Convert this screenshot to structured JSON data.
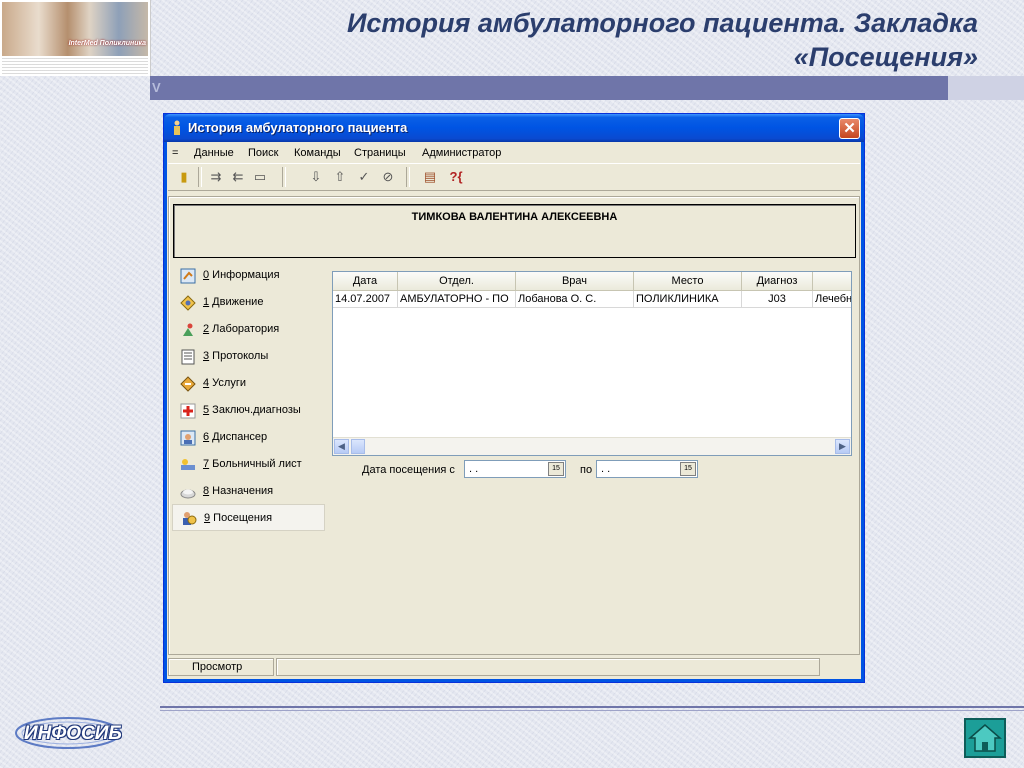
{
  "slide": {
    "title_line1": "История амбулаторного пациента. Закладка",
    "title_line2": "«Посещения»",
    "banner_logo": "InterMed Поликлиника",
    "footer_logo": "ИНФОСИБ",
    "corner_mark": "V"
  },
  "window": {
    "title": "История амбулаторного пациента",
    "close_glyph": "✕"
  },
  "menu": {
    "items": [
      "=",
      "Данные",
      "Поиск",
      "Команды",
      "Страницы",
      "Администратор"
    ]
  },
  "toolbar": {
    "glyphs": [
      "▮",
      "⇉",
      "⇇",
      "▭",
      "⇩",
      "⇧",
      "✓",
      "⊘",
      "▤",
      "?{"
    ]
  },
  "patient": {
    "name": "ТИМКОВА ВАЛЕНТИНА АЛЕКСЕЕВНА"
  },
  "nav": {
    "items": [
      {
        "label": "0 Информация",
        "icon": "info-icon"
      },
      {
        "label": "1 Движение",
        "icon": "movement-icon"
      },
      {
        "label": "2 Лаборатория",
        "icon": "lab-icon"
      },
      {
        "label": "3 Протоколы",
        "icon": "protocols-icon"
      },
      {
        "label": "4 Услуги",
        "icon": "services-icon"
      },
      {
        "label": "5 Заключ.диагнозы",
        "icon": "diagnosis-icon"
      },
      {
        "label": "6 Диспансер",
        "icon": "dispensary-icon"
      },
      {
        "label": "7 Больничный лист",
        "icon": "sick-leave-icon"
      },
      {
        "label": "8 Назначения",
        "icon": "prescriptions-icon"
      },
      {
        "label": "9 Посещения",
        "icon": "visits-icon"
      }
    ],
    "active_index": 9
  },
  "grid": {
    "columns": [
      "Дата",
      "Отдел.",
      "Врач",
      "Место",
      "Диагноз",
      ""
    ],
    "rows": [
      [
        "14.07.2007",
        "АМБУЛАТОРНО - ПО",
        "Лобанова О. С.",
        "ПОЛИКЛИНИКА",
        "J03",
        "Лечебн"
      ]
    ]
  },
  "filter": {
    "from_label": "Дата посещения с",
    "from_value": ". .",
    "to_label": "по",
    "to_value": ". .",
    "calendar_glyph": "15"
  },
  "status": {
    "mode": "Просмотр",
    "info": ""
  },
  "colors": {
    "accent": "#6f75a9",
    "title": "#2b3e6d",
    "xp_blue": "#0054e3",
    "home_button": "#1c9e98"
  }
}
